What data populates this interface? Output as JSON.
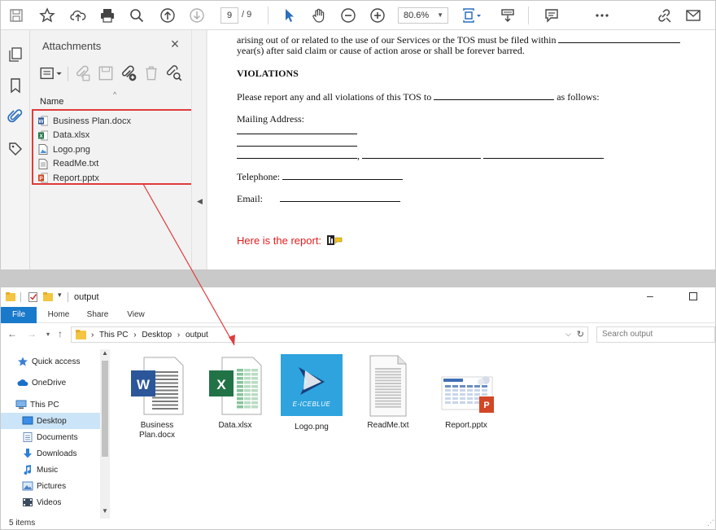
{
  "pdf": {
    "page_current": "9",
    "page_total": "/ 9",
    "zoom": "80.6%",
    "attachments": {
      "title": "Attachments",
      "column_header": "Name",
      "files": [
        {
          "name": "Business Plan.docx",
          "type": "docx"
        },
        {
          "name": "Data.xlsx",
          "type": "xlsx"
        },
        {
          "name": "Logo.png",
          "type": "png"
        },
        {
          "name": "ReadMe.txt",
          "type": "txt"
        },
        {
          "name": "Report.pptx",
          "type": "pptx"
        }
      ]
    },
    "document": {
      "line1": "arising out of or related to the use of our Services or the TOS must be filed within",
      "line2": "year(s) after said claim or cause of action arose or shall be forever barred.",
      "heading": "VIOLATIONS",
      "report_intro": "Please report any and all violations of this TOS to",
      "report_tail": "as follows:",
      "mailing_label": "Mailing Address:",
      "comma": ",",
      "telephone_label": "Telephone:",
      "email_label": "Email:",
      "report_note": "Here is the report:"
    }
  },
  "explorer": {
    "title": "output",
    "ribbon_tabs": [
      "File",
      "Home",
      "Share",
      "View"
    ],
    "breadcrumb": [
      "This PC",
      "Desktop",
      "output"
    ],
    "search_placeholder": "Search output",
    "nav_items": [
      {
        "label": "Quick access",
        "icon": "star-icon"
      },
      {
        "label": "OneDrive",
        "icon": "cloud-icon"
      },
      {
        "label": "This PC",
        "icon": "computer-icon"
      },
      {
        "label": "Desktop",
        "icon": "desktop-icon",
        "selected": true
      },
      {
        "label": "Documents",
        "icon": "documents-icon"
      },
      {
        "label": "Downloads",
        "icon": "download-icon"
      },
      {
        "label": "Music",
        "icon": "music-icon"
      },
      {
        "label": "Pictures",
        "icon": "pictures-icon"
      },
      {
        "label": "Videos",
        "icon": "videos-icon"
      }
    ],
    "files": [
      {
        "label": "Business Plan.docx",
        "type": "docx"
      },
      {
        "label": "Data.xlsx",
        "type": "xlsx"
      },
      {
        "label": "Logo.png",
        "type": "png",
        "logo_text": "E-ICEBLUE"
      },
      {
        "label": "ReadMe.txt",
        "type": "txt"
      },
      {
        "label": "Report.pptx",
        "type": "pptx"
      }
    ],
    "status": "5 items"
  },
  "colors": {
    "highlight_border": "#e03b3b",
    "accent_blue": "#1979ca",
    "word_blue": "#2b579a",
    "excel_green": "#217346",
    "ppt_red": "#d24726",
    "report_red": "#e21c1c"
  }
}
